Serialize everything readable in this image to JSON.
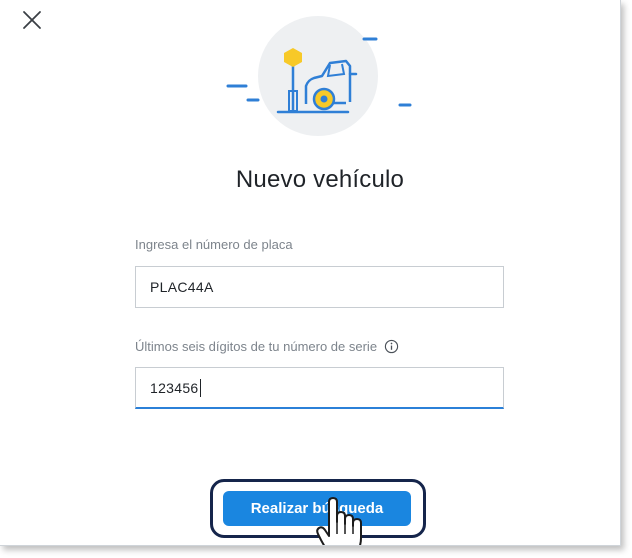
{
  "dialog": {
    "close_icon": "close-icon",
    "illustration_icon": "car-parking-icon",
    "title": "Nuevo vehículo"
  },
  "form": {
    "plate": {
      "label": "Ingresa el número de placa",
      "value": "PLAC44A"
    },
    "serial": {
      "label": "Últimos seis dígitos de tu número de serie",
      "info_icon": "info-icon",
      "value": "123456"
    },
    "search_button": {
      "label": "Realizar búsqueda"
    }
  },
  "overlay": {
    "cursor_icon": "hand-pointer-icon"
  },
  "colors": {
    "accent": "#1a86e0",
    "highlight_border": "#15254b",
    "illustration_yellow": "#f7c928",
    "illustration_blue": "#2f7fd6",
    "illustration_bg": "#eef0f2"
  }
}
